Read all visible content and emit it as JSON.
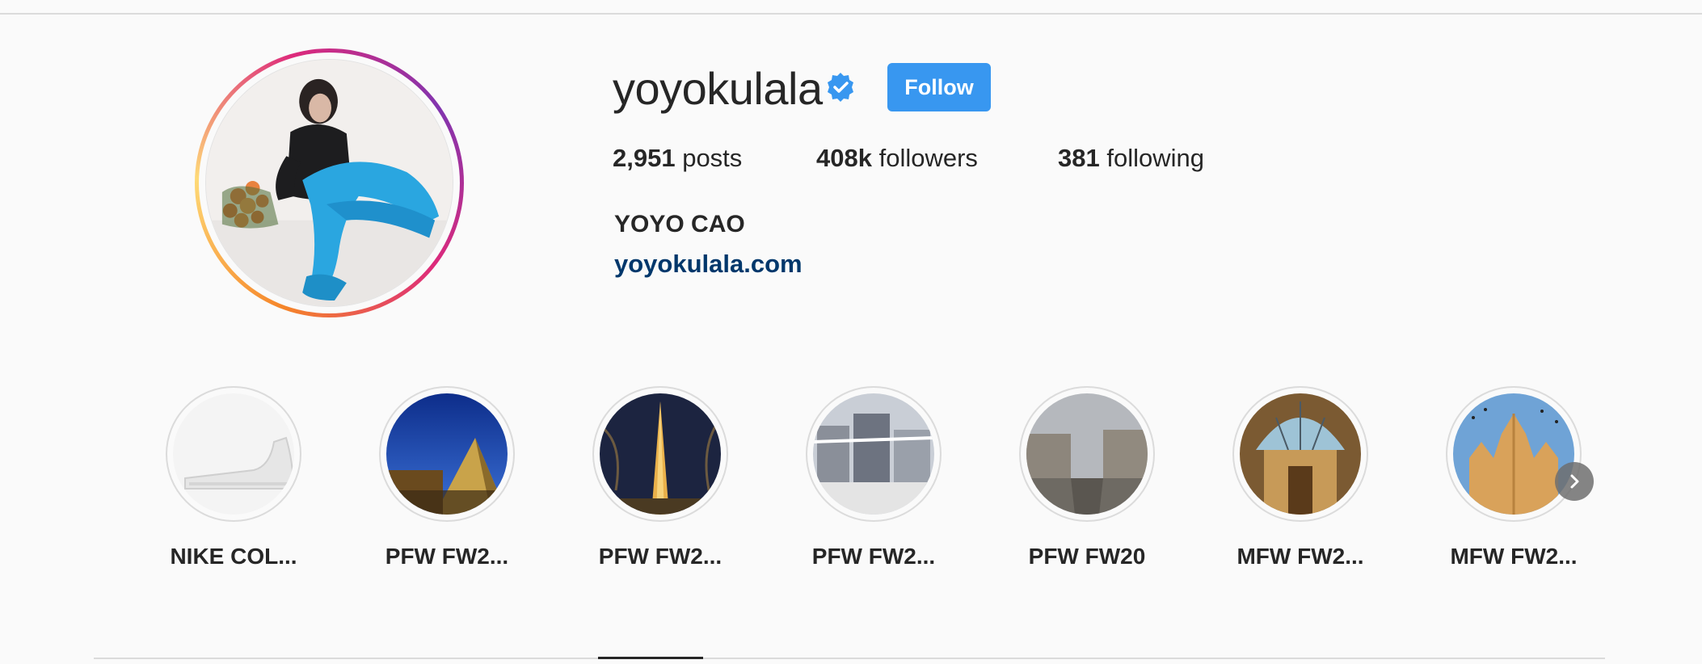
{
  "profile": {
    "username": "yoyokulala",
    "verified_icon": "verified-badge-icon",
    "follow_label": "Follow",
    "stats": [
      {
        "count": "2,951",
        "label": "posts"
      },
      {
        "count": "408k",
        "label": "followers"
      },
      {
        "count": "381",
        "label": "following"
      }
    ],
    "full_name": "YOYO CAO",
    "website": "yoyokulala.com"
  },
  "highlights": [
    {
      "label": "NIKE COL..."
    },
    {
      "label": "PFW FW2..."
    },
    {
      "label": "PFW FW2..."
    },
    {
      "label": "PFW FW2..."
    },
    {
      "label": "PFW FW20"
    },
    {
      "label": "MFW FW2..."
    },
    {
      "label": "MFW FW2..."
    }
  ],
  "colors": {
    "follow_button": "#3897f0",
    "link": "#00376b",
    "text": "#262626",
    "background": "#fafafa"
  },
  "icons": {
    "next": "chevron-right-icon"
  }
}
